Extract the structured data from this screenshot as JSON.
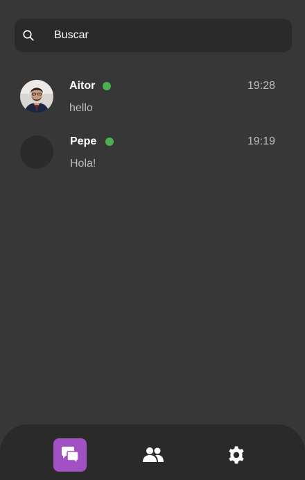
{
  "search": {
    "placeholder": "Buscar",
    "icon": "search-icon"
  },
  "chats": [
    {
      "name": "Aitor",
      "online": true,
      "time": "19:28",
      "preview": "hello",
      "avatar": "photo"
    },
    {
      "name": "Pepe",
      "online": true,
      "time": "19:19",
      "preview": "Hola!",
      "avatar": "placeholder"
    }
  ],
  "nav": {
    "items": [
      {
        "icon": "chat-bubbles-icon",
        "active": true
      },
      {
        "icon": "people-icon",
        "active": false
      },
      {
        "icon": "gear-icon",
        "active": false
      }
    ]
  },
  "colors": {
    "background": "#373737",
    "surface": "#2a2a2a",
    "accent": "#a251c4",
    "online": "#4caf50",
    "secondary_text": "#bdbdbd"
  }
}
